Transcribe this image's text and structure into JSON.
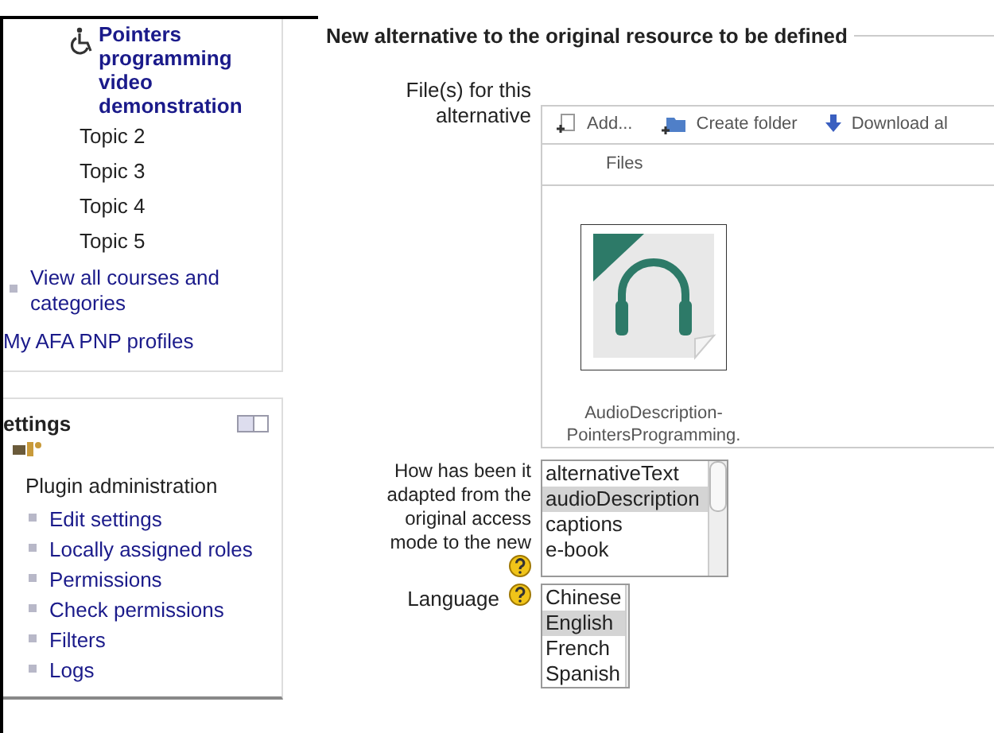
{
  "sidebar": {
    "current_item": {
      "label": "Pointers programming video demonstration"
    },
    "topics": [
      "Topic 2",
      "Topic 3",
      "Topic 4",
      "Topic 5"
    ],
    "links": [
      {
        "label": "View all courses and categories"
      }
    ],
    "profiles_link": "My AFA PNP profiles"
  },
  "settings": {
    "title": "ettings",
    "section": "Plugin administration",
    "items": [
      "Edit settings",
      "Locally assigned roles",
      "Permissions",
      "Check permissions",
      "Filters",
      "Logs"
    ]
  },
  "form": {
    "legend": "New alternative to the original resource to be defined",
    "files_label": "File(s) for this alternative",
    "toolbar": [
      "Add...",
      "Create folder",
      "Download al"
    ],
    "files_header": "Files",
    "file": {
      "name": "AudioDescription-PointersProgramming."
    },
    "adaptation": {
      "label": "How has been it adapted from the original access mode to the new",
      "options": [
        {
          "label": "alternativeText",
          "selected": false
        },
        {
          "label": "audioDescription",
          "selected": true
        },
        {
          "label": "captions",
          "selected": false
        },
        {
          "label": "e-book",
          "selected": false
        }
      ]
    },
    "language": {
      "label": "Language",
      "options": [
        {
          "label": "Chinese",
          "selected": false
        },
        {
          "label": "English",
          "selected": true
        },
        {
          "label": "French",
          "selected": false
        },
        {
          "label": "Spanish",
          "selected": false
        }
      ]
    }
  }
}
